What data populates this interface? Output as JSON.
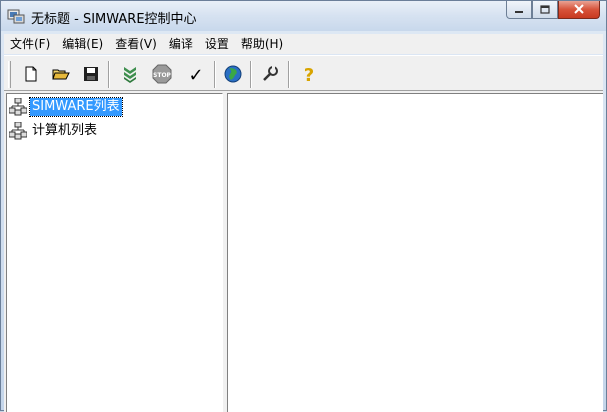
{
  "window": {
    "title": "无标题 - SIMWARE控制中心"
  },
  "menu": {
    "items": [
      "文件(F)",
      "编辑(E)",
      "查看(V)",
      "编译",
      "设置",
      "帮助(H)"
    ]
  },
  "toolbar": {
    "buttons": [
      {
        "name": "new-document",
        "icon": "new-document-icon"
      },
      {
        "name": "open-folder",
        "icon": "open-folder-icon"
      },
      {
        "name": "save",
        "icon": "floppy-disk-icon"
      },
      {
        "name": "build",
        "icon": "green-arrows-icon"
      },
      {
        "name": "stop",
        "icon": "stop-sign-icon",
        "label": "STOP"
      },
      {
        "name": "check",
        "icon": "check-mark-icon",
        "glyph": "✓"
      },
      {
        "name": "globe",
        "icon": "globe-icon"
      },
      {
        "name": "tools",
        "icon": "wrench-icon"
      },
      {
        "name": "help",
        "icon": "question-mark-icon",
        "glyph": "?"
      }
    ]
  },
  "tree": {
    "items": [
      {
        "label": "SIMWARE列表",
        "selected": true,
        "icon": "network-computers-icon"
      },
      {
        "label": "计算机列表",
        "selected": false,
        "icon": "network-computers-icon"
      }
    ]
  },
  "colors": {
    "selection": "#3399ff",
    "close_button": "#c83a20",
    "window_frame": "#c8d8ec"
  }
}
